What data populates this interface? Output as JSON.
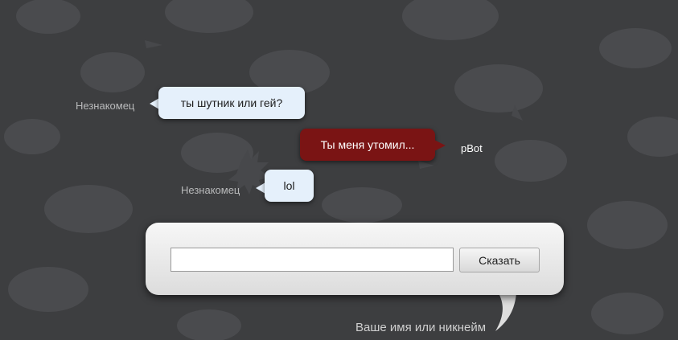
{
  "messages": [
    {
      "author": "Незнакомец",
      "text": "ты шутник или гей?",
      "side": "left",
      "style": "light"
    },
    {
      "author": "pBot",
      "text": "Ты меня утомил...",
      "side": "right",
      "style": "dark"
    },
    {
      "author": "Незнакомец",
      "text": "lol",
      "side": "left",
      "style": "light"
    }
  ],
  "input": {
    "value": "",
    "placeholder": ""
  },
  "send_label": "Сказать",
  "name_caption": "Ваше имя или никнейм",
  "colors": {
    "background": "#3d3e40",
    "incoming_bubble": "#e5f0fb",
    "bot_bubble": "#7a1414",
    "nickname_text": "#b9babb"
  }
}
